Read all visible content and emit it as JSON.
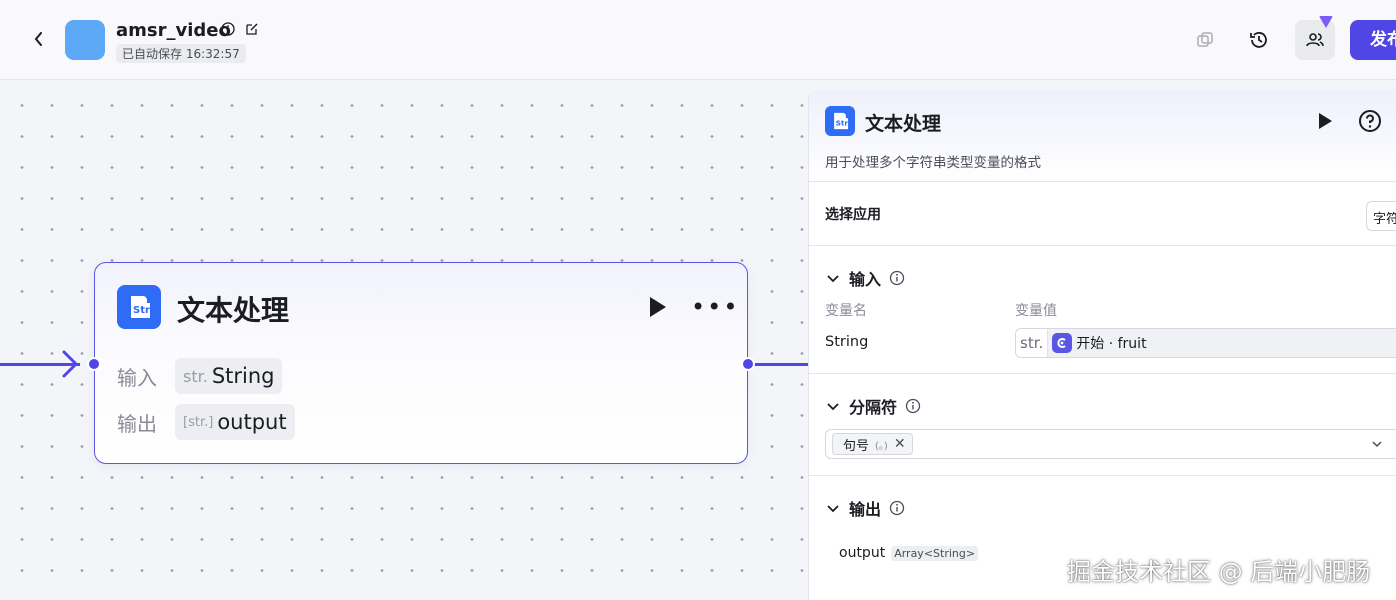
{
  "header": {
    "app_name": "amsr_video",
    "autosave": "已自动保存 16:32:57",
    "publish_label": "发布"
  },
  "node": {
    "title": "文本处理",
    "input_label": "输入",
    "input_type": "str.",
    "input_value": "String",
    "output_label": "输出",
    "output_type": "[str.]",
    "output_value": "output"
  },
  "panel": {
    "title": "文本处理",
    "description": "用于处理多个字符串类型变量的格式",
    "app_select_label": "选择应用",
    "app_select_value": "字符串拼接",
    "input_section": {
      "title": "输入",
      "col_name": "变量名",
      "col_value": "变量值",
      "var_name": "String",
      "var_type": "str.",
      "var_ref": "开始 · fruit"
    },
    "separator_section": {
      "title": "分隔符",
      "tag_label": "句号",
      "tag_sub": "(。)"
    },
    "output_section": {
      "title": "输出",
      "name": "output",
      "type": "Array<String>"
    }
  },
  "watermark": "掘金技术社区 @ 后端小肥肠",
  "colors": {
    "primary": "#4f46e5",
    "node_icon": "#2f6cf6",
    "app_avatar": "#5ea8f8"
  }
}
